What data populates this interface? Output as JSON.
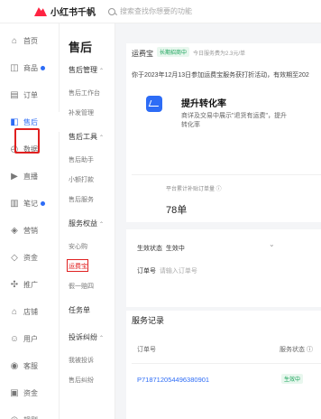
{
  "header": {
    "logo_text": "小红书千帆",
    "search_placeholder": "搜索查找你想要的功能"
  },
  "rail": [
    {
      "label": "首页",
      "icon": "⌂"
    },
    {
      "label": "商品",
      "icon": "◫",
      "dot": true
    },
    {
      "label": "订单",
      "icon": "▤"
    },
    {
      "label": "售后",
      "icon": "◧",
      "active": true
    },
    {
      "label": "数据",
      "icon": "◴"
    },
    {
      "label": "直播",
      "icon": "▶"
    },
    {
      "label": "笔记",
      "icon": "▥",
      "dot": true
    },
    {
      "label": "营销",
      "icon": "◈"
    },
    {
      "label": "资金",
      "icon": "◇"
    },
    {
      "label": "推广",
      "icon": "✣"
    },
    {
      "label": "店铺",
      "icon": "⌂"
    },
    {
      "label": "用户",
      "icon": "☺"
    },
    {
      "label": "客服",
      "icon": "◉"
    },
    {
      "label": "资金",
      "icon": "▣"
    },
    {
      "label": "规则",
      "icon": "◎"
    }
  ],
  "submenu": {
    "title": "售后",
    "groups": [
      {
        "label": "售后管理",
        "items": [
          "售后工作台",
          "补发管理"
        ]
      },
      {
        "label": "售后工具",
        "items": [
          "售后助手",
          "小额打款",
          "售后服务"
        ]
      },
      {
        "label": "服务权益",
        "items": [
          "安心购",
          "运费宝",
          "假一赔四"
        ]
      },
      {
        "label": "任务单",
        "items": []
      },
      {
        "label": "投诉纠纷",
        "items": [
          "我被投诉",
          "售后纠纷"
        ]
      }
    ]
  },
  "main": {
    "service_name": "运费宝",
    "service_badge": "长期招商中",
    "service_note": "今日服务费为2.3元/单",
    "notice": "你于2023年12月13日参加运费宝服务获打折活动，有效期至202",
    "promo_title": "提升转化率",
    "promo_desc": "商详及交易中展示\"退货有运费\"，提升转化率",
    "stat_label": "平台累计补贴订单量 ⓘ",
    "stat_value": "78单",
    "filter_status_label": "生效状态",
    "filter_status_value": "生效中",
    "filter_order_label": "订单号",
    "filter_order_placeholder": "请输入订单号",
    "records_title": "服务记录",
    "col_order": "订单号",
    "col_status": "服务状态 ⓘ",
    "row_order": "P718712054496380901",
    "row_status": "生效中"
  }
}
